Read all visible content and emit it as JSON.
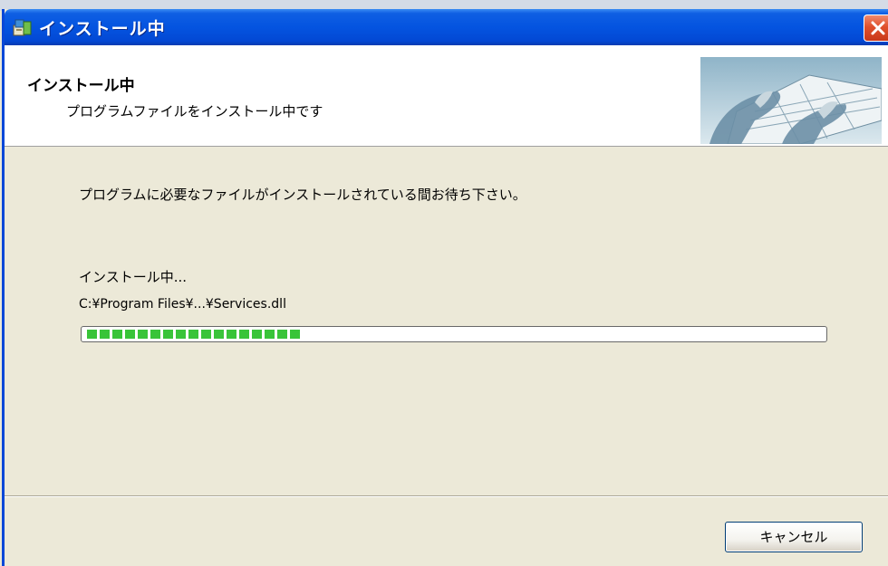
{
  "window": {
    "title": "インストール中",
    "icon": "installer-icon",
    "close_icon": "close-icon"
  },
  "header": {
    "title": "インストール中",
    "subtitle": "プログラムファイルをインストール中です",
    "image": "keyboard-typing-image"
  },
  "content": {
    "message": "プログラムに必要なファイルがインストールされている間お待ち下さい。",
    "status_label": "インストール中...",
    "current_file": "C:¥Program Files¥...¥Services.dll",
    "progress": 0.3,
    "progress_color": "#39c439"
  },
  "footer": {
    "cancel_label": "キャンセル"
  },
  "colors": {
    "titlebar": "#0454e0",
    "close_button": "#e0502c",
    "dialog_bg": "#ece9d8"
  }
}
